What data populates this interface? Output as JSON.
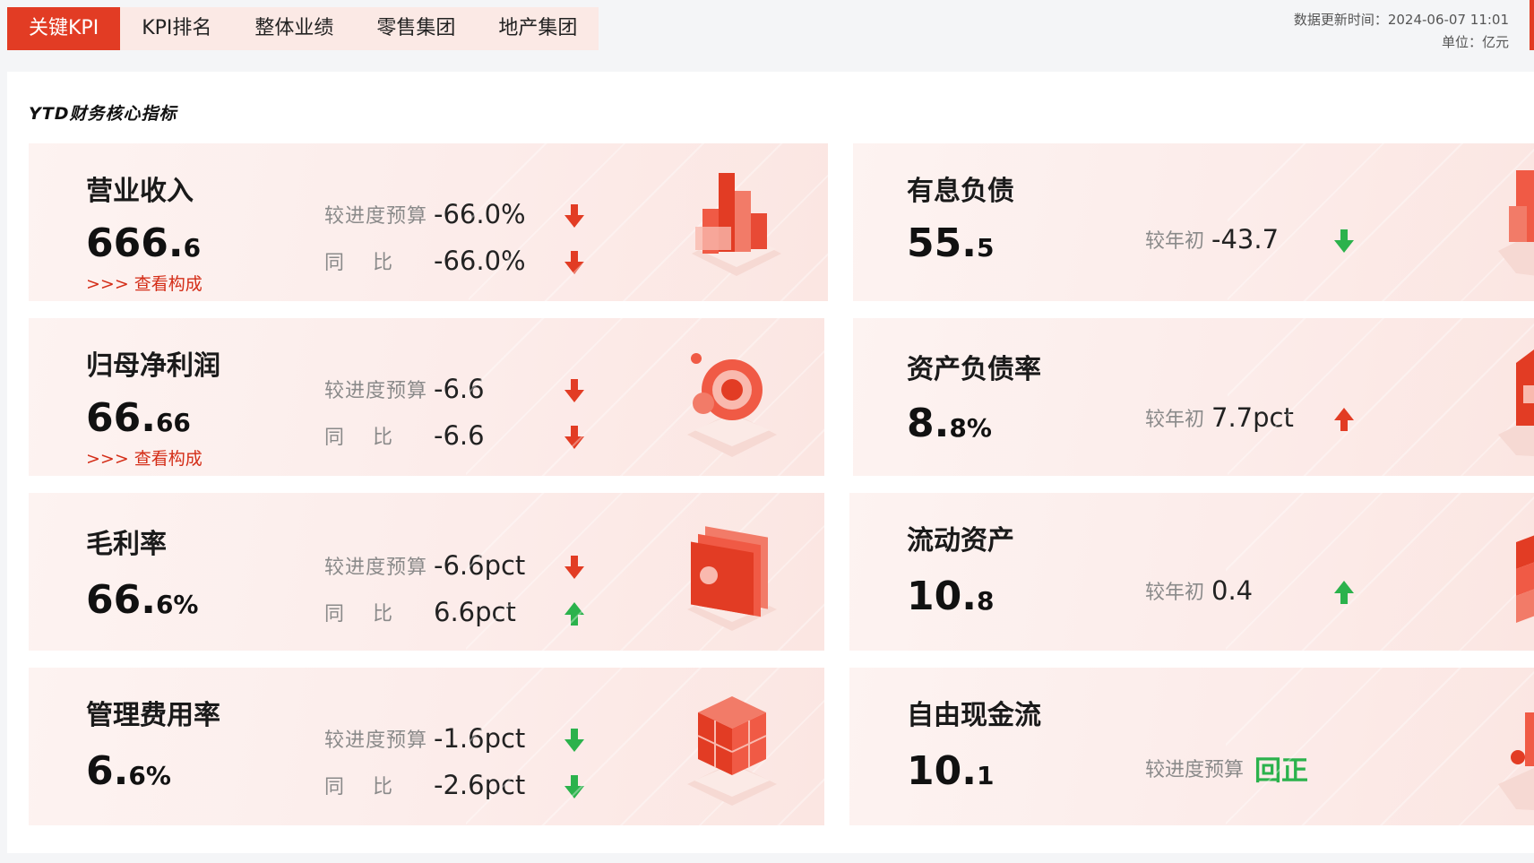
{
  "tabs": [
    {
      "label": "关键KPI",
      "active": true
    },
    {
      "label": "KPI排名",
      "active": false
    },
    {
      "label": "整体业绩",
      "active": false
    },
    {
      "label": "零售集团",
      "active": false
    },
    {
      "label": "地产集团",
      "active": false
    }
  ],
  "meta": {
    "update_time": "数据更新时间：2024-06-07 11:01",
    "unit": "单位：亿元"
  },
  "section_title": "YTD财务核心指标",
  "colors": {
    "accent": "#e23c24",
    "up": "#e23c24",
    "down_good": "#2bb24c"
  },
  "left_cards": [
    {
      "title": "营业收入",
      "value_big": "666.",
      "value_small": "6",
      "link": ">>> 查看构成",
      "rows": [
        {
          "label": "较进度预算",
          "value": "-66.0%",
          "arrow": "down",
          "arrow_color": "red"
        },
        {
          "label": "同　 比",
          "value": "-66.0%",
          "arrow": "down",
          "arrow_color": "red"
        }
      ],
      "icon": "bar-chart-icon"
    },
    {
      "title": "归母净利润",
      "value_big": "66.",
      "value_small": "66",
      "link": ">>> 查看构成",
      "rows": [
        {
          "label": "较进度预算",
          "value": "-6.6",
          "arrow": "down",
          "arrow_color": "red"
        },
        {
          "label": "同　 比",
          "value": "-6.6",
          "arrow": "down",
          "arrow_color": "red"
        }
      ],
      "icon": "coins-icon"
    },
    {
      "title": "毛利率",
      "value_big": "66.",
      "value_small": "6%",
      "link": "",
      "rows": [
        {
          "label": "较进度预算",
          "value": "-6.6pct",
          "arrow": "down",
          "arrow_color": "red"
        },
        {
          "label": "同　 比",
          "value": "6.6pct",
          "arrow": "up",
          "arrow_color": "green"
        }
      ],
      "icon": "wallet-icon"
    },
    {
      "title": "管理费用率",
      "value_big": "6.",
      "value_small": "6%",
      "link": "",
      "rows": [
        {
          "label": "较进度预算",
          "value": "-1.6pct",
          "arrow": "down",
          "arrow_color": "green"
        },
        {
          "label": "同　 比",
          "value": "-2.6pct",
          "arrow": "down",
          "arrow_color": "green"
        }
      ],
      "icon": "cubes-icon"
    }
  ],
  "right_cards": [
    {
      "title": "有息负债",
      "value_big": "55.",
      "value_small": "5",
      "label": "较年初",
      "value": "-43.7",
      "arrow": "down",
      "arrow_color": "green"
    },
    {
      "title": "资产负债率",
      "value_big": "8.",
      "value_small": "8%",
      "label": "较年初",
      "value": "7.7pct",
      "arrow": "up",
      "arrow_color": "red"
    },
    {
      "title": "流动资产",
      "value_big": "10.",
      "value_small": "8",
      "label": "较年初",
      "value": "0.4",
      "arrow": "up",
      "arrow_color": "green"
    },
    {
      "title": "自由现金流",
      "value_big": "10.",
      "value_small": "1",
      "label": "较进度预算",
      "value": "回正",
      "arrow": "",
      "arrow_color": "green"
    }
  ]
}
